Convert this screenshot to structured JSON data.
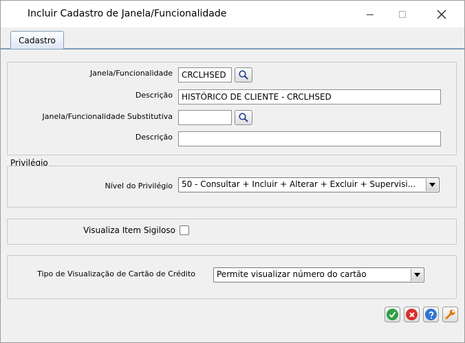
{
  "window": {
    "title": "Incluir Cadastro de Janela/Funcionalidade"
  },
  "tabs": [
    {
      "label": "Cadastro"
    }
  ],
  "form": {
    "janela_label": "Janela/Funcionalidade",
    "janela_value": "CRCLHSED",
    "descricao_label": "Descrição",
    "descricao_value": "HISTÓRICO DE CLIENTE - CRCLHSED",
    "substitutiva_label": "Janela/Funcionalidade Substitutiva",
    "substitutiva_value": "",
    "descricao2_label": "Descrição",
    "descricao2_value": ""
  },
  "privilegio": {
    "section_title": "Privilégio",
    "nivel_label": "Nível do Privilégio",
    "nivel_value": "50 - Consultar + Incluir + Alterar + Excluir + Supervisi..."
  },
  "sigiloso": {
    "label": "Visualiza Item Sigiloso",
    "checked": false
  },
  "cartao": {
    "label": "Tipo de Visualização de Cartão de Crédito",
    "value": "Permite visualizar número do cartão"
  },
  "icons": {
    "lookup": "magnifier-icon",
    "confirm": "check-icon",
    "cancel": "x-icon",
    "help": "question-icon",
    "tools": "wrench-icon"
  },
  "colors": {
    "confirm": "#2ea043",
    "cancel": "#d9302c",
    "help": "#2f74d0",
    "tools": "#e07a10",
    "tab_border": "#7f9db9"
  }
}
